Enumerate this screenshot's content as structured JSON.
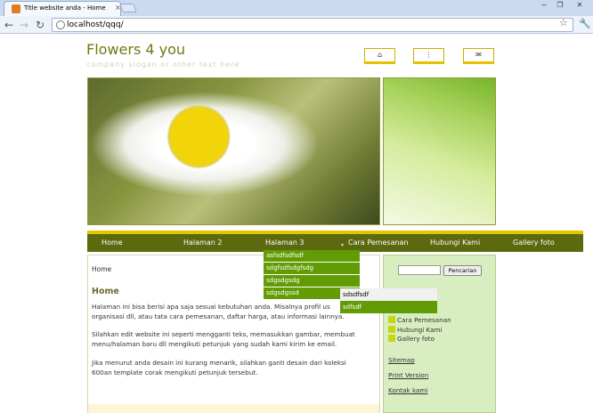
{
  "browser": {
    "tab_title": "Title website anda - Home",
    "tab_close": "×",
    "url": "localhost/qqq/",
    "window_min": "−",
    "window_max": "❐",
    "window_close": "✕"
  },
  "site": {
    "title": "Flowers 4 you",
    "slogan": "company slogan or other text here",
    "top_icons": [
      "home-icon",
      "sitemap-icon",
      "mail-icon"
    ]
  },
  "nav": {
    "items": [
      "Home",
      "Halaman 2",
      "Halaman 3",
      "Cara Pemesanan",
      "Hubungi Kami",
      "Gallery foto"
    ],
    "dropdown": [
      "asfsdfsdfsdf",
      "sdgfsdfsdgfsdg",
      "sdgsdgsdg",
      "sdgsdgssd"
    ],
    "subdropdown": [
      "sdsdfsdf",
      "sdfsdf"
    ]
  },
  "content": {
    "breadcrumb": "Home",
    "title": "Home",
    "para1_line1": "Halaman ini bisa berisi apa saja sesuai kebutuhan anda. Misalnya profil us",
    "para1_line2": "organisasi dll, atau tata cara pemesanan, daftar harga, atau informasi lainnya.",
    "para2_line1": "Silahkan edit website ini seperti mengganti teks, memasukkan gambar, membuat",
    "para2_line2": "menu/halaman baru dll mengikuti petunjuk yang sudah kami kirim ke email.",
    "para3_line1": "Jika menurut anda desain ini kurang menarik, silahkan ganti desain dari koleksi",
    "para3_line2": "600an template corak mengikuti petunjuk tersebut."
  },
  "sidebar": {
    "search_button": "Pencarian",
    "menu": [
      "Cara Pemesanan",
      "Hubungi Kami",
      "Gallery foto"
    ],
    "links": [
      "Sitemap",
      "Print Version",
      "Kontak kami"
    ]
  },
  "colors": {
    "nav_bg": "#5b690f",
    "accent_yellow": "#e3c500",
    "dropdown_green": "#629c04",
    "sidebar_bg": "#d8eec0"
  }
}
